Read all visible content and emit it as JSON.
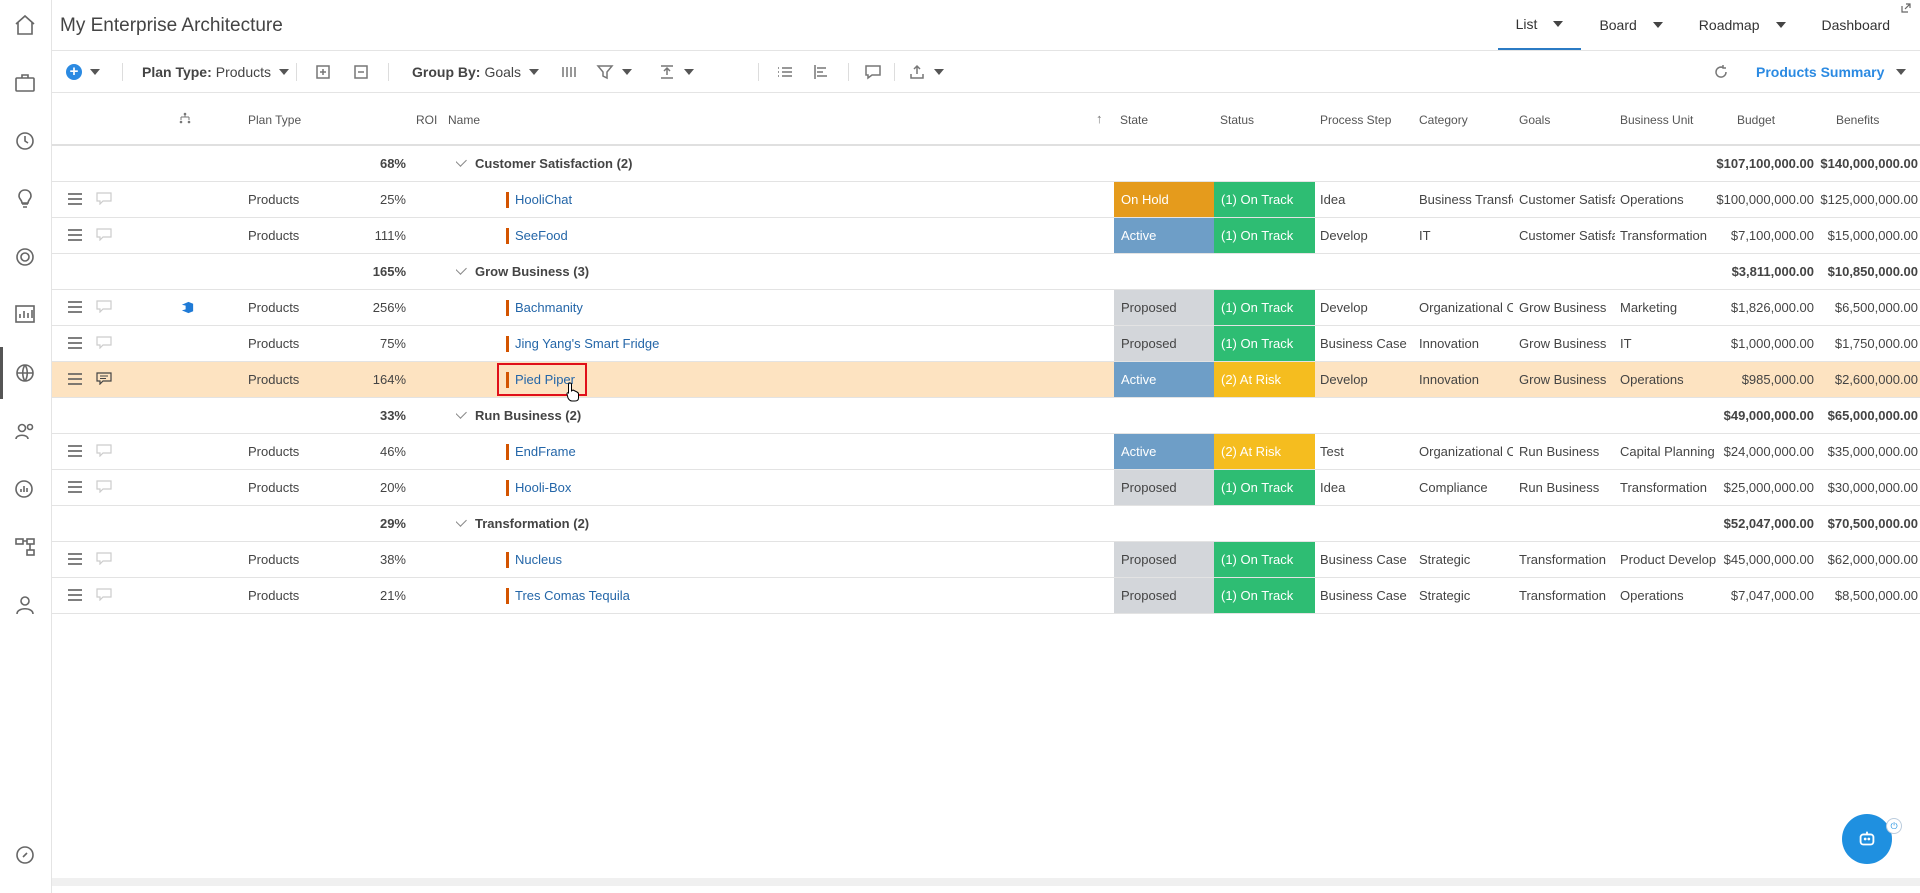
{
  "app": {
    "title": "My Enterprise Architecture"
  },
  "view_tabs": {
    "list": "List",
    "board": "Board",
    "roadmap": "Roadmap",
    "dashboard": "Dashboard"
  },
  "toolbar": {
    "plan_type_label": "Plan Type:",
    "plan_type_value": "Products",
    "group_by_label": "Group By:",
    "group_by_value": "Goals",
    "summary": "Products Summary"
  },
  "columns": {
    "plan_type": "Plan Type",
    "roi": "ROI",
    "name": "Name",
    "state": "State",
    "status": "Status",
    "process_step": "Process Step",
    "category": "Category",
    "goals": "Goals",
    "business_unit": "Business Unit",
    "budget": "Budget",
    "benefits": "Benefits"
  },
  "groups": [
    {
      "roi": "68%",
      "label": "Customer Satisfaction (2)",
      "budget": "$107,100,000.00",
      "benefits": "$140,000,000.00"
    },
    {
      "roi": "165%",
      "label": "Grow Business (3)",
      "budget": "$3,811,000.00",
      "benefits": "$10,850,000.00"
    },
    {
      "roi": "33%",
      "label": "Run Business (2)",
      "budget": "$49,000,000.00",
      "benefits": "$65,000,000.00"
    },
    {
      "roi": "29%",
      "label": "Transformation (2)",
      "budget": "$52,047,000.00",
      "benefits": "$70,500,000.00"
    }
  ],
  "rows": [
    {
      "plan_type": "Products",
      "roi": "25%",
      "name": "HooliChat",
      "state": "On Hold",
      "status": "(1) On Track",
      "process_step": "Idea",
      "category": "Business Transfo",
      "goals": "Customer Satisfa",
      "business_unit": "Operations",
      "budget": "$100,000,000.00",
      "benefits": "$125,000,000.00"
    },
    {
      "plan_type": "Products",
      "roi": "111%",
      "name": "SeeFood",
      "state": "Active",
      "status": "(1) On Track",
      "process_step": "Develop",
      "category": "IT",
      "goals": "Customer Satisfa",
      "business_unit": "Transformation",
      "budget": "$7,100,000.00",
      "benefits": "$15,000,000.00"
    },
    {
      "plan_type": "Products",
      "roi": "256%",
      "name": "Bachmanity",
      "state": "Proposed",
      "status": "(1) On Track",
      "process_step": "Develop",
      "category": "Organizational C",
      "goals": "Grow Business",
      "business_unit": "Marketing",
      "budget": "$1,826,000.00",
      "benefits": "$6,500,000.00"
    },
    {
      "plan_type": "Products",
      "roi": "75%",
      "name": "Jing Yang's Smart Fridge",
      "state": "Proposed",
      "status": "(1) On Track",
      "process_step": "Business Case",
      "category": "Innovation",
      "goals": "Grow Business",
      "business_unit": "IT",
      "budget": "$1,000,000.00",
      "benefits": "$1,750,000.00"
    },
    {
      "plan_type": "Products",
      "roi": "164%",
      "name": "Pied Piper",
      "state": "Active",
      "status": "(2) At Risk",
      "process_step": "Develop",
      "category": "Innovation",
      "goals": "Grow Business",
      "business_unit": "Operations",
      "budget": "$985,000.00",
      "benefits": "$2,600,000.00"
    },
    {
      "plan_type": "Products",
      "roi": "46%",
      "name": "EndFrame",
      "state": "Active",
      "status": "(2) At Risk",
      "process_step": "Test",
      "category": "Organizational C",
      "goals": "Run Business",
      "business_unit": "Capital Planning",
      "budget": "$24,000,000.00",
      "benefits": "$35,000,000.00"
    },
    {
      "plan_type": "Products",
      "roi": "20%",
      "name": "Hooli-Box",
      "state": "Proposed",
      "status": "(1) On Track",
      "process_step": "Idea",
      "category": "Compliance",
      "goals": "Run Business",
      "business_unit": "Transformation",
      "budget": "$25,000,000.00",
      "benefits": "$30,000,000.00"
    },
    {
      "plan_type": "Products",
      "roi": "38%",
      "name": "Nucleus",
      "state": "Proposed",
      "status": "(1) On Track",
      "process_step": "Business Case",
      "category": "Strategic",
      "goals": "Transformation",
      "business_unit": "Product Develop",
      "budget": "$45,000,000.00",
      "benefits": "$62,000,000.00"
    },
    {
      "plan_type": "Products",
      "roi": "21%",
      "name": "Tres Comas Tequila",
      "state": "Proposed",
      "status": "(1) On Track",
      "process_step": "Business Case",
      "category": "Strategic",
      "goals": "Transformation",
      "business_unit": "Operations",
      "budget": "$7,047,000.00",
      "benefits": "$8,500,000.00"
    }
  ],
  "colors": {
    "accent": "#2b8ae2",
    "on_hold": "#e59b1c",
    "active": "#6e9ec7",
    "proposed": "#d3d6da",
    "on_track": "#2ebd73",
    "at_risk": "#f5bd1f",
    "highlight_row": "#fde3c1",
    "selection_box": "#e0101a"
  }
}
